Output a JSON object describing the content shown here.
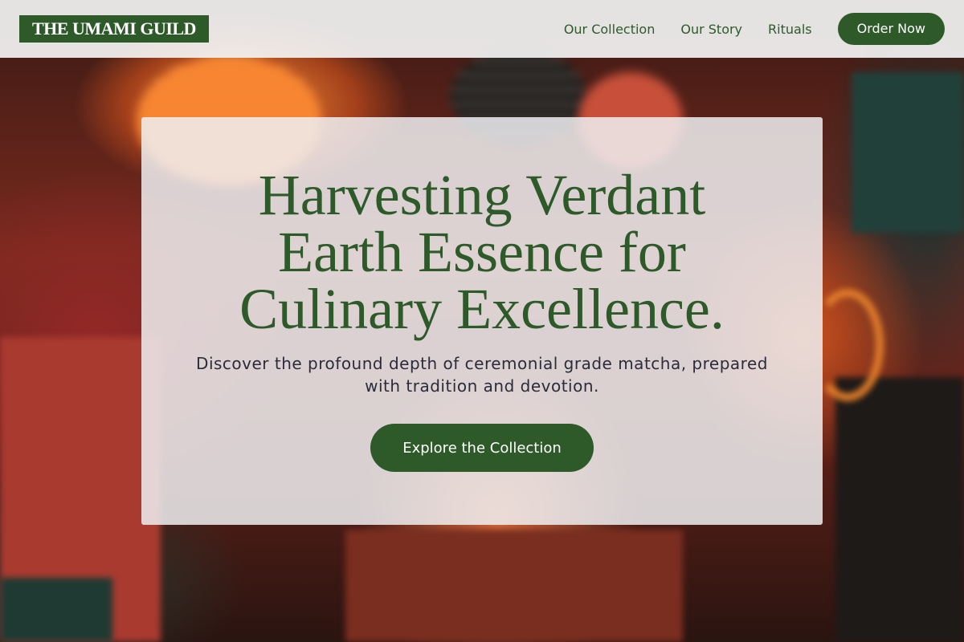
{
  "header": {
    "logo": "THE UMAMI GUILD",
    "nav": [
      {
        "label": "Our Collection"
      },
      {
        "label": "Our Story"
      },
      {
        "label": "Rituals"
      }
    ],
    "cta_label": "Order Now"
  },
  "hero": {
    "title_lines": [
      "Harvesting Verdant",
      "Earth Essence for",
      "Culinary Excellence."
    ],
    "subtitle": "Discover the profound depth of ceremonial grade matcha, prepared with tradition and devotion.",
    "button_label": "Explore the Collection"
  },
  "colors": {
    "brand_green": "#2e5a2a",
    "header_bg": "#f2f2f2",
    "text_dark": "#2b2b3a"
  }
}
